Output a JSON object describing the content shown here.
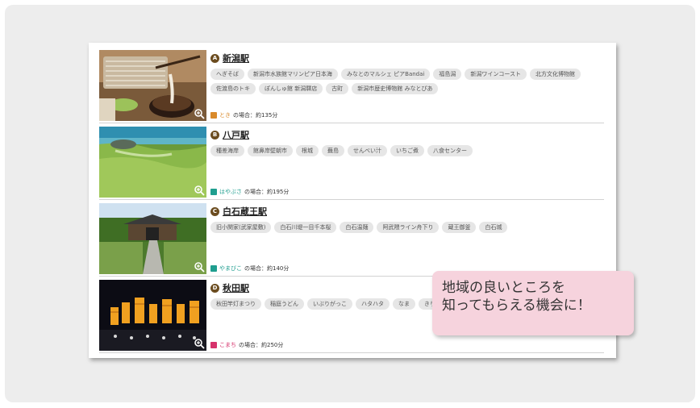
{
  "colors": {
    "toki": "#d98a2b",
    "hayabusa": "#1f9e8f",
    "yamabiko": "#1f9e8f",
    "komachi": "#d6336c",
    "mark": "#6b4c1f"
  },
  "rows": [
    {
      "mark": "A",
      "station": "新潟駅",
      "tags": [
        "へぎそば",
        "新潟市水族館マリンピア日本海",
        "みなとのマルシェ ピアBandai",
        "福島潟",
        "新潟ワインコースト",
        "北方文化博物館",
        "佐渡島のトキ",
        "ぽんしゅ館 新潟驛店",
        "古町",
        "新潟市歴史博物館 みなとぴあ"
      ],
      "train_name": "とき",
      "train_time": "の場合：約135分",
      "image_icon": "soba-photo",
      "zoom_icon": "zoom-icon"
    },
    {
      "mark": "B",
      "station": "八戸駅",
      "tags": [
        "種差海岸",
        "館鼻岸壁朝市",
        "根城",
        "蕪島",
        "せんべい汁",
        "いちご煮",
        "八食センター"
      ],
      "train_name": "はやぶさ",
      "train_time": "の場合：約195分",
      "image_icon": "coast-photo",
      "zoom_icon": "zoom-icon"
    },
    {
      "mark": "C",
      "station": "白石蔵王駅",
      "tags": [
        "旧小関家(武家屋敷)",
        "白石川堤一目千本桜",
        "白石温麺",
        "阿武隈ライン舟下り",
        "蔵王御釜",
        "白石城"
      ],
      "train_name": "やまびこ",
      "train_time": "の場合：約140分",
      "image_icon": "samurai-house-photo",
      "zoom_icon": "zoom-icon"
    },
    {
      "mark": "D",
      "station": "秋田駅",
      "tags": [
        "秋田竿灯まつり",
        "稲庭うどん",
        "いぶりがっこ",
        "ハタハタ",
        "なま",
        "きりたんぽ鍋"
      ],
      "train_name": "こまち",
      "train_time": "の場合：約250分",
      "image_icon": "kanto-festival-photo",
      "zoom_icon": "zoom-icon"
    }
  ],
  "callout": {
    "line1": "地域の良いところを",
    "line2": "知ってもらえる機会に！"
  }
}
